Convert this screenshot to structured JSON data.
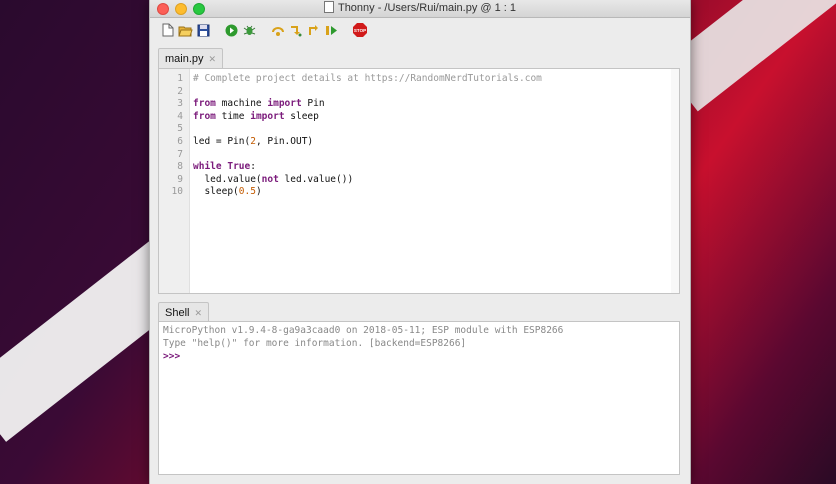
{
  "window": {
    "title": "Thonny  -  /Users/Rui/main.py  @  1 : 1"
  },
  "toolbar": {
    "buttons": [
      {
        "name": "new-file-icon"
      },
      {
        "name": "open-file-icon"
      },
      {
        "name": "save-file-icon"
      },
      {
        "name": "run-icon"
      },
      {
        "name": "debug-icon"
      },
      {
        "name": "step-over-icon"
      },
      {
        "name": "step-into-icon"
      },
      {
        "name": "step-out-icon"
      },
      {
        "name": "resume-icon"
      },
      {
        "name": "stop-icon"
      }
    ],
    "stop_label": "STOP"
  },
  "editor": {
    "tab_label": "main.py",
    "line_numbers": [
      "1",
      "2",
      "3",
      "4",
      "5",
      "6",
      "7",
      "8",
      "9",
      "10"
    ],
    "lines": [
      "# Complete project details at https://RandomNerdTutorials.com",
      "",
      "from machine import Pin",
      "from time import sleep",
      "",
      "led = Pin(2, Pin.OUT)",
      "",
      "while True:",
      "  led.value(not led.value())",
      "  sleep(0.5)"
    ]
  },
  "shell": {
    "tab_label": "Shell",
    "lines": [
      "MicroPython v1.9.4-8-ga9a3caad0 on 2018-05-11; ESP module with ESP8266",
      "Type \"help()\" for more information. [backend=ESP8266]"
    ],
    "prompt": ">>>"
  },
  "colors": {
    "keyword": "#7b1b7b",
    "comment": "#999999",
    "number": "#c25a00",
    "run_green": "#2e9a2e",
    "stop_red": "#d11a1a"
  }
}
